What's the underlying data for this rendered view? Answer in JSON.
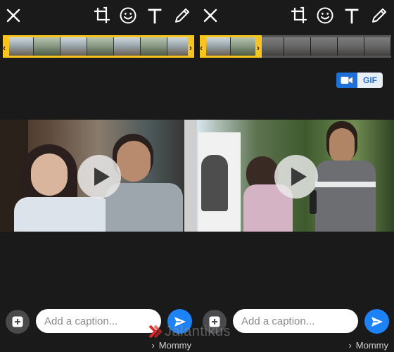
{
  "toolbar": {
    "icons": [
      "close-icon",
      "crop-icon",
      "emoji-icon",
      "text-icon",
      "pencil-icon"
    ]
  },
  "format_toggle": {
    "gif_label": "GIF",
    "selected": "video",
    "active_color": "#1f6fd8"
  },
  "composer": {
    "placeholder": "Add a caption...",
    "send_color": "#1d82f5"
  },
  "recipient": {
    "name": "Mommy"
  },
  "watermark": {
    "text": "Jalantikus"
  },
  "colors": {
    "background": "#1a1a1b",
    "trim_handle": "#f7c51e"
  }
}
